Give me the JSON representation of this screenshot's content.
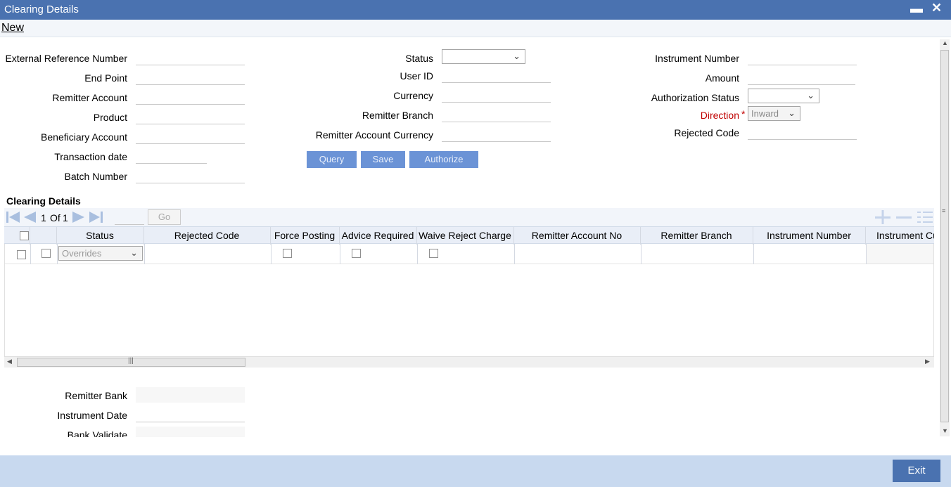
{
  "window": {
    "title": "Clearing Details",
    "minimize": "▬",
    "close": "✕"
  },
  "menu": {
    "new": "New"
  },
  "form": {
    "external_reference_number": "External Reference Number",
    "end_point": "End Point",
    "remitter_account": "Remitter Account",
    "product": "Product",
    "beneficiary_account": "Beneficiary Account",
    "transaction_date": "Transaction date",
    "batch_number": "Batch Number",
    "status": "Status",
    "user_id": "User ID",
    "currency": "Currency",
    "remitter_branch": "Remitter Branch",
    "remitter_account_currency": "Remitter Account Currency",
    "instrument_number": "Instrument Number",
    "amount": "Amount",
    "authorization_status": "Authorization Status",
    "direction": "Direction",
    "direction_required": "*",
    "direction_value": "Inward",
    "rejected_code": "Rejected Code"
  },
  "buttons": {
    "query": "Query",
    "save": "Save",
    "authorize": "Authorize"
  },
  "grid": {
    "section_title": "Clearing Details",
    "page_current": "1",
    "page_of": "Of",
    "page_total": "1",
    "go": "Go",
    "columns": [
      "Status",
      "Rejected Code",
      "Force Posting",
      "Advice Required",
      "Waive Reject Charge",
      "Remitter Account No",
      "Remitter Branch",
      "Instrument Number",
      "Instrument Cu"
    ],
    "row": {
      "status_value": "Overrides"
    }
  },
  "bottom": {
    "remitter_bank": "Remitter Bank",
    "instrument_date": "Instrument Date",
    "bank_validate": "Bank Validate"
  },
  "footer": {
    "exit": "Exit"
  },
  "colors": {
    "titlebar": "#4a72b0",
    "button": "#6b93d6",
    "footer": "#c8d9ef",
    "required": "#c00000"
  }
}
